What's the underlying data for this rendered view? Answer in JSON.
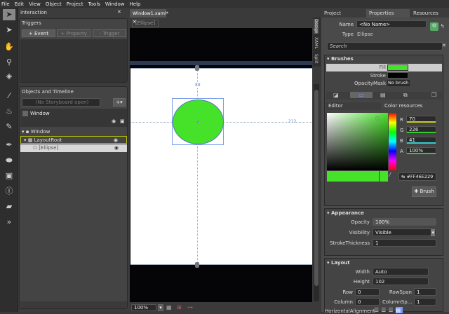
{
  "menu": [
    "File",
    "Edit",
    "View",
    "Object",
    "Project",
    "Tools",
    "Window",
    "Help"
  ],
  "tools": [
    "selection-icon",
    "direct-select-icon",
    "pan-icon",
    "zoom-icon",
    "camera-orbit-icon",
    "eyedropper-icon",
    "paint-bucket-icon",
    "brush-transform-icon",
    "pen-icon",
    "ellipse-icon",
    "grid-icon",
    "textblock-icon",
    "asset-icon",
    "more-icon"
  ],
  "interaction": {
    "title": "Interaction",
    "triggers": "Triggers",
    "event_btn": "+ Event",
    "property_btn": "+ Property",
    "trigger_btn": "- Trigger"
  },
  "objects": {
    "title": "Objects and Timeline",
    "storyboard": "(No Storyboard open)",
    "scope": "Window",
    "tree": [
      "Window",
      "LayoutRoot",
      "[Ellipse]"
    ]
  },
  "document": {
    "tab": "Window1.xaml*",
    "breadcrumb": "[Ellipse]",
    "top_margin": "88",
    "right_margin": "212",
    "zoom": "100%",
    "view_tabs": [
      "Design",
      "XAML",
      "Split"
    ],
    "fill_color": "#46E229"
  },
  "right_tabs": [
    "Project",
    "Properties",
    "Resources"
  ],
  "props": {
    "name_label": "Name",
    "name_value": "<No Name>",
    "type_label": "Type",
    "type_value": "Ellipse",
    "search_placeholder": "Search"
  },
  "brushes": {
    "title": "Brushes",
    "fill": "Fill",
    "stroke": "Stroke",
    "opacity_mask": "OpacityMask",
    "no_brush": "No brush",
    "editor": "Editor",
    "color_resources": "Color resources",
    "r_label": "R",
    "r": "70",
    "g_label": "G",
    "g": "226",
    "b_label": "B",
    "b": "41",
    "a_label": "A",
    "a": "100%",
    "hex": "#FF46E229",
    "brush_btn": "Brush"
  },
  "appearance": {
    "title": "Appearance",
    "opacity_label": "Opacity",
    "opacity": "100%",
    "visibility_label": "Visibility",
    "visibility": "Visible",
    "stroke_label": "StrokeThickness",
    "stroke": "1"
  },
  "layout": {
    "title": "Layout",
    "width_label": "Width",
    "width": "Auto",
    "height_label": "Height",
    "height": "102",
    "row_label": "Row",
    "row": "0",
    "rowspan_label": "RowSpan",
    "rowspan": "1",
    "column_label": "Column",
    "column": "0",
    "colspan_label": "ColumnSp...",
    "colspan": "1",
    "ha_label": "HorizontalAlignment"
  }
}
